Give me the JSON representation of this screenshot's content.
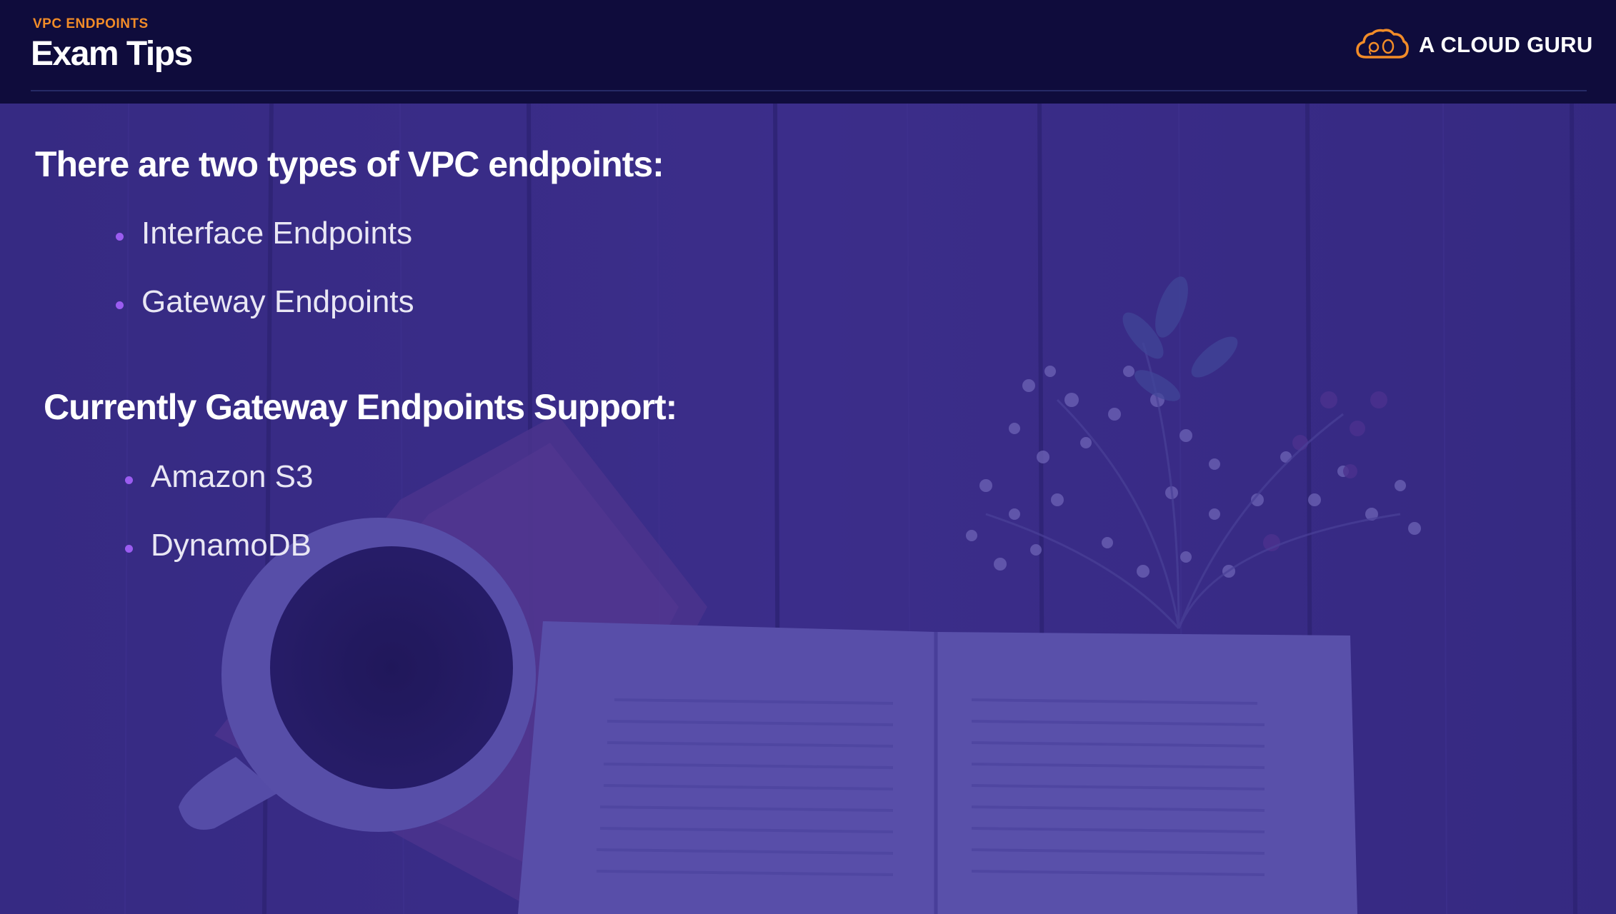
{
  "header": {
    "section_label": "VPC ENDPOINTS",
    "title": "Exam Tips",
    "brand_name": "A CLOUD GURU"
  },
  "content": {
    "heading_1": "There are two types of VPC endpoints:",
    "list_1": [
      "Interface Endpoints",
      "Gateway Endpoints"
    ],
    "heading_2": "Currently Gateway Endpoints Support:",
    "list_2": [
      "Amazon S3",
      "DynamoDB"
    ]
  },
  "colors": {
    "header_bg": "#0f0c3c",
    "accent_orange": "#f28c28",
    "bullet_purple": "#9b5cf0",
    "overlay_purple": "#3a2c8c"
  }
}
